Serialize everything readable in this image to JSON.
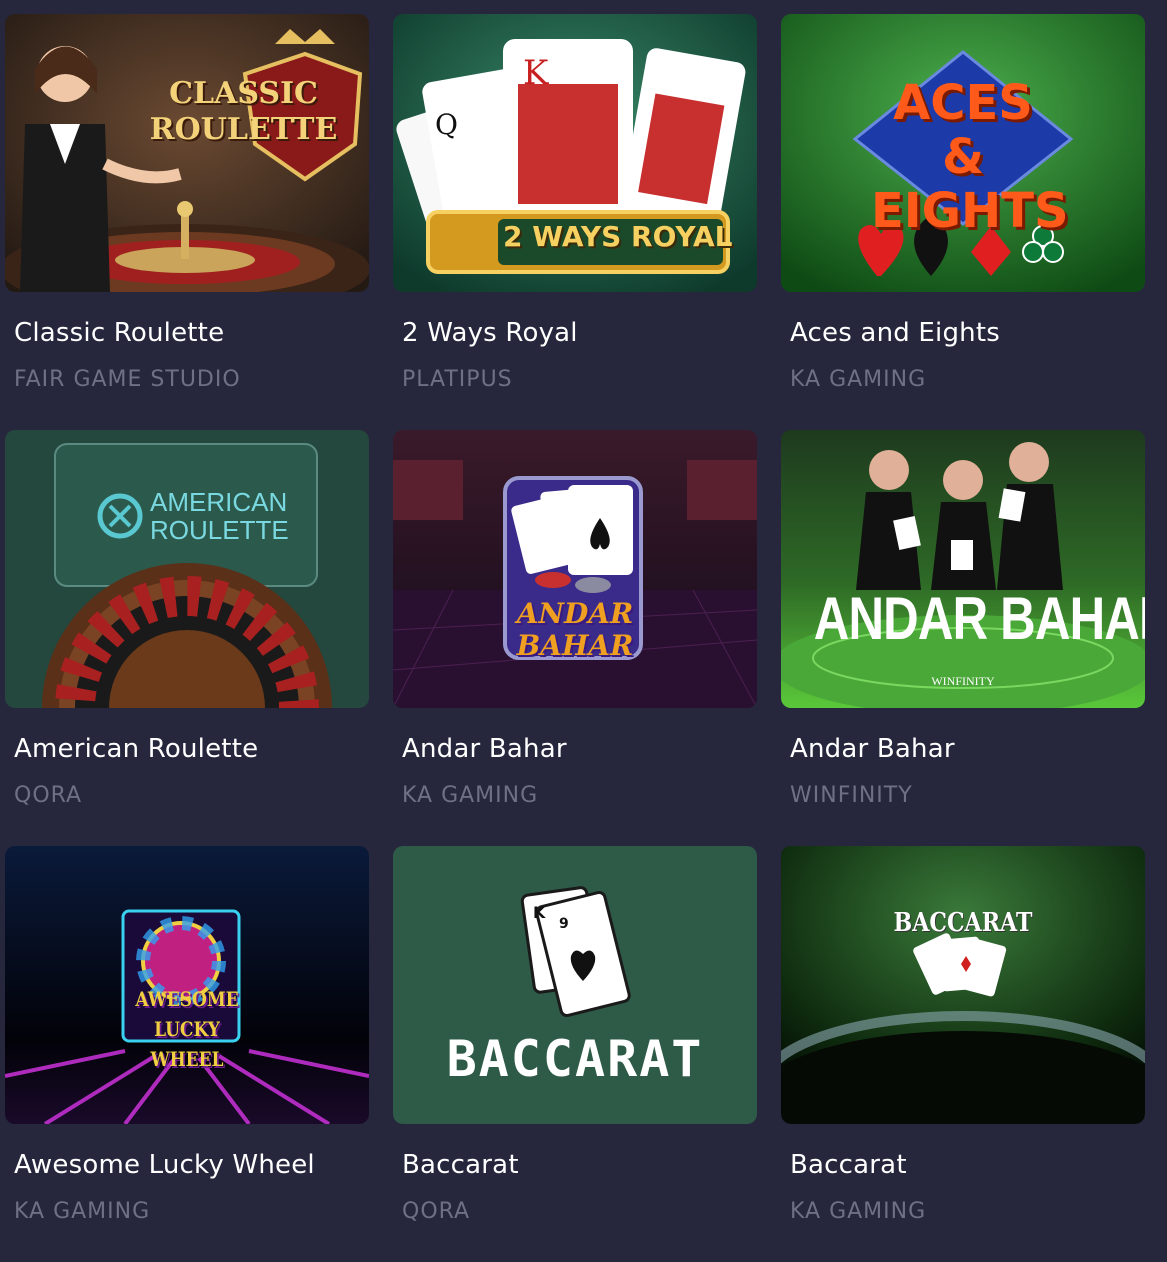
{
  "games": [
    {
      "title": "Classic Roulette",
      "provider": "FAIR GAME STUDIO",
      "thumb_text": "CLASSIC ROULETTE",
      "icon": "roulette-dealer-icon"
    },
    {
      "title": "2 Ways Royal",
      "provider": "PLATIPUS",
      "thumb_text": "2 WAYS ROYAL",
      "icon": "playing-cards-icon"
    },
    {
      "title": "Aces and Eights",
      "provider": "KA GAMING",
      "thumb_text": "ACES & EIGHTS",
      "icon": "card-suits-icon"
    },
    {
      "title": "American Roulette",
      "provider": "QORA",
      "thumb_text": "AMERICAN ROULETTE",
      "icon": "roulette-wheel-icon"
    },
    {
      "title": "Andar Bahar",
      "provider": "KA GAMING",
      "thumb_text": "ANDAR BAHAR",
      "icon": "cards-and-chips-icon"
    },
    {
      "title": "Andar Bahar",
      "provider": "WINFINITY",
      "thumb_text": "ANDAR BAHAR",
      "thumb_subtext": "WINFINITY",
      "icon": "dealers-icon"
    },
    {
      "title": "Awesome Lucky Wheel",
      "provider": "KA GAMING",
      "thumb_text": "AWESOME LUCKY WHEEL",
      "icon": "lucky-wheel-icon"
    },
    {
      "title": "Baccarat",
      "provider": "QORA",
      "thumb_text": "BACCARAT",
      "icon": "two-cards-icon"
    },
    {
      "title": "Baccarat",
      "provider": "KA GAMING",
      "thumb_text": "BACCARAT",
      "icon": "baccarat-table-icon"
    }
  ],
  "colors": {
    "background": "#26263d",
    "title": "#ffffff",
    "provider": "#6f6f85"
  }
}
